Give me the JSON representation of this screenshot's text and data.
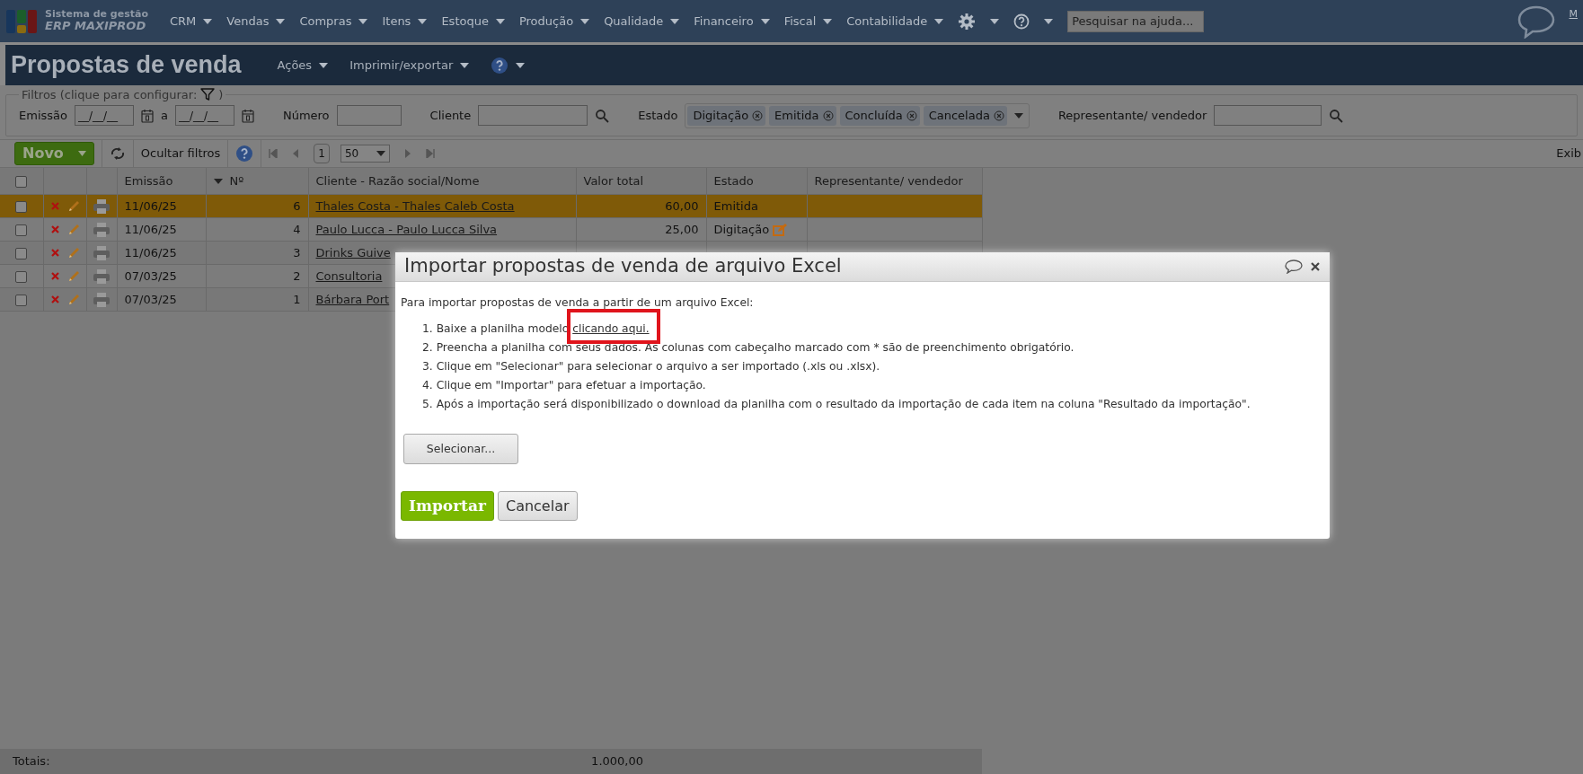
{
  "app": {
    "logo_title": "Sistema de gestão",
    "logo_name": "ERP MAXIPROD"
  },
  "menu": [
    {
      "label": "CRM"
    },
    {
      "label": "Vendas"
    },
    {
      "label": "Compras"
    },
    {
      "label": "Itens"
    },
    {
      "label": "Estoque"
    },
    {
      "label": "Produção"
    },
    {
      "label": "Qualidade"
    },
    {
      "label": "Financeiro"
    },
    {
      "label": "Fiscal"
    },
    {
      "label": "Contabilidade"
    }
  ],
  "help_search": {
    "placeholder": "Pesquisar na ajuda..."
  },
  "top_right_link": "M",
  "page": {
    "title": "Propostas de venda",
    "menus": [
      {
        "label": "Ações"
      },
      {
        "label": "Imprimir/exportar"
      }
    ]
  },
  "filters": {
    "legend": "Filtros (clique para configurar:",
    "legend_close": ")",
    "fields": [
      {
        "kind": "date_range",
        "label": "Emissão",
        "from_value": "__/__/__",
        "separator": "a",
        "to_value": "__/__/__"
      },
      {
        "kind": "text",
        "label": "Número"
      },
      {
        "kind": "search",
        "label": "Cliente"
      },
      {
        "kind": "tags",
        "label": "Estado",
        "tags": [
          "Digitação",
          "Emitida",
          "Concluída",
          "Cancelada"
        ]
      },
      {
        "kind": "search",
        "label": "Representante/ vendedor"
      }
    ]
  },
  "toolbar": {
    "new_button": "Novo",
    "hide_filters": "Ocultar filtros",
    "page": "1",
    "page_size": "50",
    "right_text": "Exib"
  },
  "table": {
    "all_checked": false,
    "columns": [
      {
        "label": "Emissão",
        "sorted": false
      },
      {
        "label": "Nº",
        "sorted": true
      },
      {
        "label": "Cliente - Razão social/Nome",
        "sorted": false
      },
      {
        "label": "Valor total",
        "sorted": false
      },
      {
        "label": "Estado",
        "sorted": false
      },
      {
        "label": "Representante/ vendedor",
        "sorted": false
      }
    ],
    "rows": [
      {
        "selected": true,
        "checked": false,
        "emissao": "11/06/25",
        "numero": "6",
        "cliente": "Thales Costa - Thales Caleb Costa",
        "valor": "60,00",
        "estado": "Emitida",
        "state_editable": false
      },
      {
        "selected": false,
        "checked": false,
        "emissao": "11/06/25",
        "numero": "4",
        "cliente": "Paulo Lucca - Paulo Lucca Silva",
        "valor": "25,00",
        "estado": "Digitação",
        "state_editable": true
      },
      {
        "selected": false,
        "checked": false,
        "emissao": "11/06/25",
        "numero": "3",
        "cliente": "Drinks Guive"
      },
      {
        "selected": false,
        "checked": false,
        "emissao": "07/03/25",
        "numero": "2",
        "cliente": "Consultoria"
      },
      {
        "selected": false,
        "checked": false,
        "emissao": "07/03/25",
        "numero": "1",
        "cliente": "Bárbara Port"
      }
    ],
    "totals": {
      "label": "Totais:",
      "valor": "1.000,00"
    }
  },
  "modal": {
    "title": "Importar propostas de venda de arquivo Excel",
    "intro": "Para importar propostas de venda a partir de um arquivo Excel:",
    "steps": [
      {
        "number": "1.",
        "text": "Baixe a planilha modelo ",
        "link": "clicando aqui.",
        "highlighted": true
      },
      {
        "number": "2.",
        "text": "Preencha a planilha com seus dados. As colunas com cabeçalho marcado com * são de preenchimento obrigatório."
      },
      {
        "number": "3.",
        "text": "Clique em \"Selecionar\" para selecionar o arquivo a ser importado (.xls ou .xlsx)."
      },
      {
        "number": "4.",
        "text": "Clique em \"Importar\" para efetuar a importação."
      },
      {
        "number": "5.",
        "text": "Após a importação será disponibilizado o download da planilha com o resultado da importação de cada item na coluna \"Resultado da importação\"."
      }
    ],
    "select_button": "Selecionar...",
    "import_button": "Importar",
    "cancel_button": "Cancelar"
  }
}
